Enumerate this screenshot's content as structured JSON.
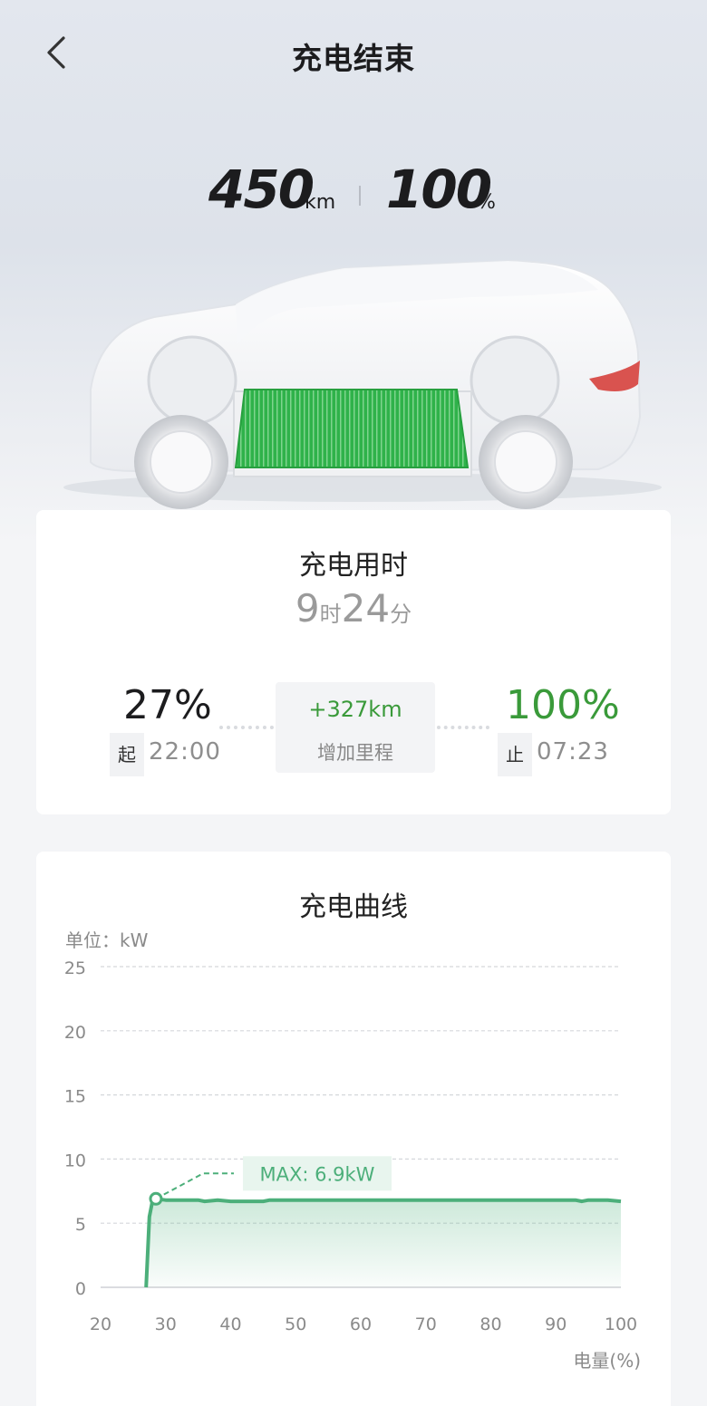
{
  "header": {
    "title": "充电结束"
  },
  "summary": {
    "range": "450",
    "range_unit": "km",
    "battery": "100",
    "battery_unit": "%"
  },
  "duration_card": {
    "title": "充电用时",
    "hours": "9",
    "hours_unit": "时",
    "minutes": "24",
    "minutes_unit": "分",
    "start_percent": "27%",
    "start_tag": "起",
    "start_time": "22:00",
    "added_range": "+327km",
    "added_range_label": "增加里程",
    "end_percent": "100%",
    "end_tag": "止",
    "end_time": "07:23"
  },
  "curve_card": {
    "title": "充电曲线",
    "unit_label": "单位：kW",
    "max_label": "MAX: 6.9kW"
  },
  "colors": {
    "accent_green": "#3a9a3a",
    "curve_green": "#4caf7a",
    "battery_green": "#2fb24a",
    "taillight": "#d9534f"
  },
  "icons": {
    "back": "chevron-left-icon"
  },
  "chart_data": {
    "type": "area",
    "title": "充电曲线",
    "xlabel": "电量(%)",
    "ylabel": "单位：kW",
    "xlim": [
      20,
      100
    ],
    "ylim": [
      0,
      25
    ],
    "x_ticks": [
      20,
      30,
      40,
      50,
      60,
      70,
      80,
      90,
      100
    ],
    "y_ticks": [
      0,
      5,
      10,
      15,
      20,
      25
    ],
    "grid": true,
    "series": [
      {
        "values": [
          [
            27,
            0
          ],
          [
            27.5,
            5.5
          ],
          [
            28,
            6.8
          ],
          [
            28.5,
            6.9
          ],
          [
            30,
            6.8
          ],
          [
            35,
            6.8
          ],
          [
            36,
            6.7
          ],
          [
            38,
            6.8
          ],
          [
            40,
            6.7
          ],
          [
            45,
            6.7
          ],
          [
            46,
            6.8
          ],
          [
            50,
            6.8
          ],
          [
            60,
            6.8
          ],
          [
            70,
            6.8
          ],
          [
            80,
            6.8
          ],
          [
            90,
            6.8
          ],
          [
            93,
            6.8
          ],
          [
            94,
            6.7
          ],
          [
            95,
            6.8
          ],
          [
            98,
            6.8
          ],
          [
            100,
            6.7
          ]
        ]
      }
    ],
    "max_point": [
      28.5,
      6.9
    ],
    "annotation": "MAX: 6.9kW"
  }
}
